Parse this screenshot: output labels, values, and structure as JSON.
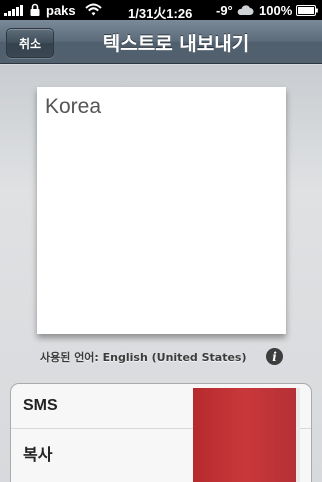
{
  "status_bar": {
    "carrier": "paks",
    "time": "1/31火1:26",
    "temperature": "-9°",
    "battery": "100%",
    "icons": [
      "signal-icon",
      "lock-icon",
      "wifi-icon",
      "cloud-icon",
      "battery-icon"
    ]
  },
  "nav": {
    "cancel_label": "취소",
    "title": "텍스트로 내보내기"
  },
  "paper": {
    "text": "Korea"
  },
  "language": {
    "label": "사용된 언어: English (United States)",
    "info_icon_glyph": "i"
  },
  "share_list": {
    "items": [
      {
        "label": "SMS"
      },
      {
        "label": "복사"
      }
    ]
  },
  "colors": {
    "nav_bar": "#5b6b79",
    "overlay_red": "#c13236",
    "background": "#d7d9dc"
  }
}
